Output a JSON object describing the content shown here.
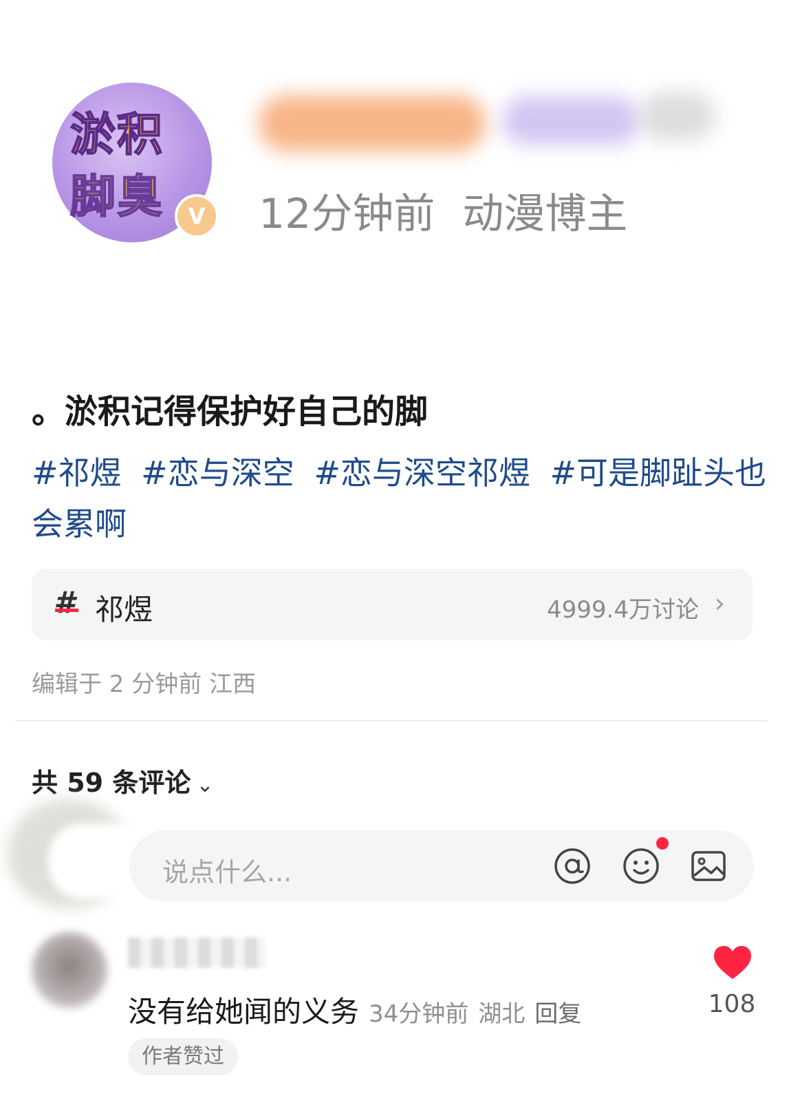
{
  "header": {
    "avatar_text_line1": "淤积",
    "avatar_text_line2": "脚臭",
    "verified_badge": "V",
    "time_ago": "12分钟前",
    "author_tag": "动漫博主"
  },
  "post": {
    "text": "。淤积记得保护好自己的脚",
    "hashtags": [
      "#祁煜",
      "#恋与深空",
      "#恋与深空祁煜",
      "#可是脚趾头也会累啊"
    ]
  },
  "topic_card": {
    "hash_symbol": "#",
    "name": "祁煜",
    "discussion_count": "4999.4万讨论",
    "chevron": "›"
  },
  "edit_info": "编辑于 2 分钟前 江西",
  "comments": {
    "count_label": "共 59 条评论",
    "sort_chevron": "⌄",
    "input_placeholder": "说点什么...",
    "icons": [
      "at-icon",
      "emoji-icon",
      "image-icon"
    ],
    "items": [
      {
        "text": "没有给她闻的义务",
        "time": "34分钟前",
        "location": "湖北",
        "reply_label": "回复",
        "likes": "108",
        "badge": "作者赞过"
      }
    ]
  },
  "colors": {
    "hashtag": "#1f4b8a",
    "accent_red": "#ff2442",
    "secondary_text": "#8a8a8a",
    "card_bg": "#f4f5f7"
  }
}
